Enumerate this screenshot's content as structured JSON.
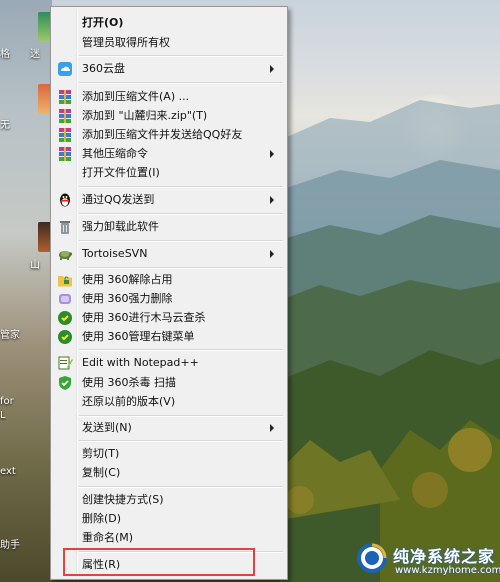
{
  "desktop": {
    "left_labels": [
      "格",
      "迷",
      "无",
      "山",
      "管家",
      "for",
      "L",
      "ext",
      "助手"
    ]
  },
  "context_menu": {
    "items": [
      {
        "label": "打开(O)",
        "icon": "none",
        "bold": true
      },
      {
        "label": "管理员取得所有权",
        "icon": "none"
      },
      {
        "label": "360云盘",
        "icon": "cloud-icon",
        "submenu": true
      },
      {
        "label": "添加到压缩文件(A) ...",
        "icon": "winrar-icon"
      },
      {
        "label": "添加到 \"山麓归来.zip\"(T)",
        "icon": "winrar-icon"
      },
      {
        "label": "添加到压缩文件并发送给QQ好友",
        "icon": "winrar-icon"
      },
      {
        "label": "其他压缩命令",
        "icon": "winrar-icon",
        "submenu": true
      },
      {
        "label": "打开文件位置(I)",
        "icon": "none"
      },
      {
        "label": "通过QQ发送到",
        "icon": "qq-penguin-icon",
        "submenu": true
      },
      {
        "label": "强力卸载此软件",
        "icon": "trash-can-icon"
      },
      {
        "label": "TortoiseSVN",
        "icon": "tortoise-svn-icon",
        "submenu": true
      },
      {
        "label": "使用 360解除占用",
        "icon": "folder-unlock-icon"
      },
      {
        "label": "使用 360强力删除",
        "icon": "shred-icon"
      },
      {
        "label": "使用 360进行木马云查杀",
        "icon": "trojan-scan-icon"
      },
      {
        "label": "使用 360管理右键菜单",
        "icon": "menu-manage-icon"
      },
      {
        "label": "Edit with Notepad++",
        "icon": "notepad-icon"
      },
      {
        "label": "使用 360杀毒 扫描",
        "icon": "shield-icon"
      },
      {
        "label": "还原以前的版本(V)",
        "icon": "none"
      },
      {
        "label": "发送到(N)",
        "icon": "none",
        "submenu": true
      },
      {
        "label": "剪切(T)",
        "icon": "none"
      },
      {
        "label": "复制(C)",
        "icon": "none"
      },
      {
        "label": "创建快捷方式(S)",
        "icon": "none"
      },
      {
        "label": "删除(D)",
        "icon": "none"
      },
      {
        "label": "重命名(M)",
        "icon": "none"
      },
      {
        "label": "属性(R)",
        "icon": "none"
      }
    ]
  },
  "watermark": {
    "title": "纯净系统之家",
    "url": "www.kzmyhome.com"
  },
  "colors": {
    "menu_bg": "#f0f0f0",
    "highlight_border": "#e5413f",
    "watermark_blue": "#1b64b4"
  }
}
